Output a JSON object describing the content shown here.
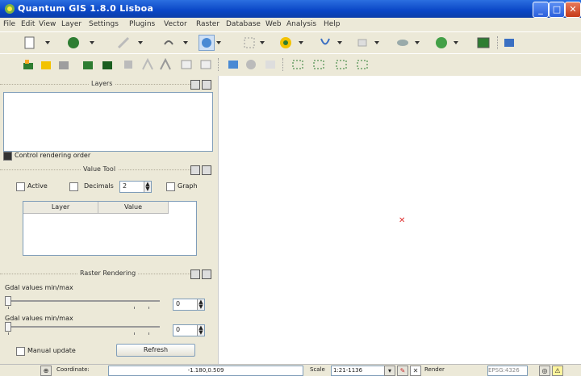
{
  "window": {
    "title": "Quantum GIS 1.8.0 Lisboa"
  },
  "menu": [
    "File",
    "Edit",
    "View",
    "Layer",
    "Settings",
    "Plugins",
    "Vector",
    "Raster",
    "Database",
    "Web",
    "Analysis",
    "Help"
  ],
  "toolbar": {
    "row1_icons": [
      "new-project-icon",
      "pan-icon",
      "pencil-icon",
      "undo-icon",
      "identify-icon",
      "zoom-icon",
      "map-tips-icon",
      "select-icon",
      "measure-icon",
      "plugin-icon",
      "globe-icon",
      "gps-icon",
      "settings-icon"
    ],
    "row2_icons": [
      "add-vector-icon",
      "add-raster-icon",
      "add-postgis-icon",
      "add-wms-icon",
      "add-wfs-icon",
      "digitize-icon",
      "node-tool-icon",
      "copy-features-icon",
      "paste-features-icon",
      "add-csv-icon",
      "geoserver-icon",
      "grass-icon",
      "topology-icon",
      "split-icon",
      "merge-icon",
      "rotate-icon",
      "offset-icon"
    ]
  },
  "layers_panel": {
    "title": "Layers",
    "control_order_label": "Control rendering order",
    "control_order_checked": true
  },
  "value_tool": {
    "title": "Value Tool",
    "active_label": "Active",
    "decimals_label": "Decimals",
    "decimals_value": "2",
    "graph_label": "Graph",
    "columns": [
      "Layer",
      "Value"
    ]
  },
  "rendering_panel": {
    "title": "Raster Rendering",
    "min_label": "Gdal values min/max",
    "min_value": "0",
    "max_label": "Gdal values min/max",
    "max_value": "0",
    "manual_update_label": "Manual update",
    "refresh_label": "Refresh"
  },
  "statusbar": {
    "coordinate_label": "Coordinate:",
    "coordinate_value": "-1.180,0.509",
    "scale_label": "Scale",
    "scale_value": "1:21-1136",
    "render_label": "Render",
    "crs_value": "EPSG:4326"
  },
  "colors": {
    "titlebar": "#0a46c6",
    "panel": "#ece9d8",
    "canvas": "#ffffff",
    "marker": "#e03030"
  }
}
